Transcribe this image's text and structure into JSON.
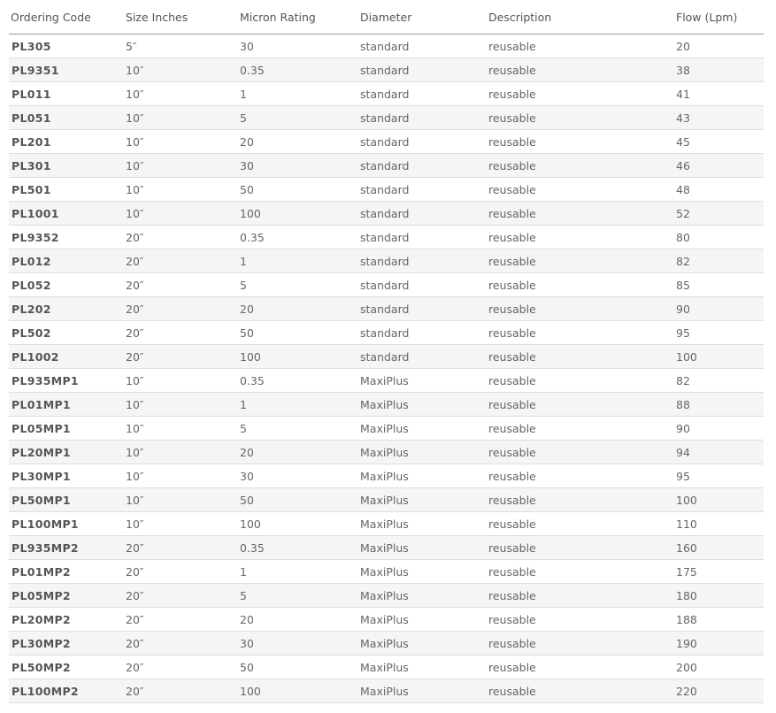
{
  "table": {
    "headers": [
      "Ordering Code",
      "Size Inches",
      "Micron Rating",
      "Diameter",
      "Description",
      "Flow (Lpm)"
    ],
    "rows": [
      [
        "PL305",
        "5″",
        "30",
        "standard",
        "reusable",
        "20"
      ],
      [
        "PL9351",
        "10″",
        "0.35",
        "standard",
        "reusable",
        "38"
      ],
      [
        "PL011",
        "10″",
        "1",
        "standard",
        "reusable",
        "41"
      ],
      [
        "PL051",
        "10″",
        "5",
        "standard",
        "reusable",
        "43"
      ],
      [
        "PL201",
        "10″",
        "20",
        "standard",
        "reusable",
        "45"
      ],
      [
        "PL301",
        "10″",
        "30",
        "standard",
        "reusable",
        "46"
      ],
      [
        "PL501",
        "10″",
        "50",
        "standard",
        "reusable",
        "48"
      ],
      [
        "PL1001",
        "10″",
        "100",
        "standard",
        "reusable",
        "52"
      ],
      [
        "PL9352",
        "20″",
        "0.35",
        "standard",
        "reusable",
        "80"
      ],
      [
        "PL012",
        "20″",
        "1",
        "standard",
        "reusable",
        "82"
      ],
      [
        "PL052",
        "20″",
        "5",
        "standard",
        "reusable",
        "85"
      ],
      [
        "PL202",
        "20″",
        "20",
        "standard",
        "reusable",
        "90"
      ],
      [
        "PL502",
        "20″",
        "50",
        "standard",
        "reusable",
        "95"
      ],
      [
        "PL1002",
        "20″",
        "100",
        "standard",
        "reusable",
        "100"
      ],
      [
        "PL935MP1",
        "10″",
        "0.35",
        "MaxiPlus",
        "reusable",
        "82"
      ],
      [
        "PL01MP1",
        "10″",
        "1",
        "MaxiPlus",
        "reusable",
        "88"
      ],
      [
        "PL05MP1",
        "10″",
        "5",
        "MaxiPlus",
        "reusable",
        "90"
      ],
      [
        "PL20MP1",
        "10″",
        "20",
        "MaxiPlus",
        "reusable",
        "94"
      ],
      [
        "PL30MP1",
        "10″",
        "30",
        "MaxiPlus",
        "reusable",
        "95"
      ],
      [
        "PL50MP1",
        "10″",
        "50",
        "MaxiPlus",
        "reusable",
        "100"
      ],
      [
        "PL100MP1",
        "10″",
        "100",
        "MaxiPlus",
        "reusable",
        "110"
      ],
      [
        "PL935MP2",
        "20″",
        "0.35",
        "MaxiPlus",
        "reusable",
        "160"
      ],
      [
        "PL01MP2",
        "20″",
        "1",
        "MaxiPlus",
        "reusable",
        "175"
      ],
      [
        "PL05MP2",
        "20″",
        "5",
        "MaxiPlus",
        "reusable",
        "180"
      ],
      [
        "PL20MP2",
        "20″",
        "20",
        "MaxiPlus",
        "reusable",
        "188"
      ],
      [
        "PL30MP2",
        "20″",
        "30",
        "MaxiPlus",
        "reusable",
        "190"
      ],
      [
        "PL50MP2",
        "20″",
        "50",
        "MaxiPlus",
        "reusable",
        "200"
      ],
      [
        "PL100MP2",
        "20″",
        "100",
        "MaxiPlus",
        "reusable",
        "220"
      ]
    ]
  },
  "colors": {
    "stripe": "#f5f5f5",
    "row_border": "#dddddd",
    "header_border": "#999999",
    "text": "#666666"
  }
}
